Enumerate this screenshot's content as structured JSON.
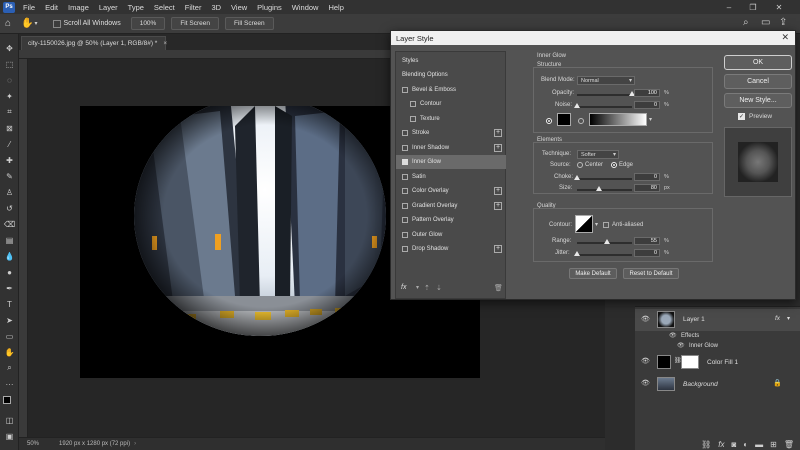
{
  "menubar": {
    "logo": "Ps",
    "items": [
      "File",
      "Edit",
      "Image",
      "Layer",
      "Type",
      "Select",
      "Filter",
      "3D",
      "View",
      "Plugins",
      "Window",
      "Help"
    ]
  },
  "optionsbar": {
    "scroll_all_windows": "Scroll All Windows",
    "zoom": "100%",
    "fit_screen": "Fit Screen",
    "fill_screen": "Fill Screen"
  },
  "document": {
    "tab_title": "city-1150026.jpg @ 50% (Layer 1, RGB/8#) *",
    "tab_close": "×",
    "zoom": "50%",
    "doc_info": "1920 px x 1280 px (72 ppi)"
  },
  "dialog": {
    "title": "Layer Style",
    "styles_header": "Styles",
    "styles": [
      {
        "label": "Blending Options",
        "checkbox": false,
        "plus": false,
        "checked": false,
        "selected": false
      },
      {
        "label": "Bevel & Emboss",
        "checkbox": true,
        "plus": false,
        "checked": false,
        "selected": false
      },
      {
        "label": "Contour",
        "checkbox": true,
        "plus": false,
        "checked": false,
        "selected": false,
        "indent": true
      },
      {
        "label": "Texture",
        "checkbox": true,
        "plus": false,
        "checked": false,
        "selected": false,
        "indent": true
      },
      {
        "label": "Stroke",
        "checkbox": true,
        "plus": true,
        "checked": false,
        "selected": false
      },
      {
        "label": "Inner Shadow",
        "checkbox": true,
        "plus": true,
        "checked": false,
        "selected": false
      },
      {
        "label": "Inner Glow",
        "checkbox": true,
        "plus": false,
        "checked": true,
        "selected": true
      },
      {
        "label": "Satin",
        "checkbox": true,
        "plus": false,
        "checked": false,
        "selected": false
      },
      {
        "label": "Color Overlay",
        "checkbox": true,
        "plus": true,
        "checked": false,
        "selected": false
      },
      {
        "label": "Gradient Overlay",
        "checkbox": true,
        "plus": true,
        "checked": false,
        "selected": false
      },
      {
        "label": "Pattern Overlay",
        "checkbox": true,
        "plus": false,
        "checked": false,
        "selected": false
      },
      {
        "label": "Outer Glow",
        "checkbox": true,
        "plus": false,
        "checked": false,
        "selected": false
      },
      {
        "label": "Drop Shadow",
        "checkbox": true,
        "plus": true,
        "checked": false,
        "selected": false
      }
    ],
    "inner_glow": {
      "section_title": "Inner Glow",
      "structure": "Structure",
      "blend_mode_label": "Blend Mode:",
      "blend_mode": "Normal",
      "opacity_label": "Opacity:",
      "opacity": "100",
      "noise_label": "Noise:",
      "noise": "0",
      "percent": "%",
      "elements": "Elements",
      "technique_label": "Technique:",
      "technique": "Softer",
      "source_label": "Source:",
      "source_center": "Center",
      "source_edge": "Edge",
      "source_selected": "Edge",
      "choke_label": "Choke:",
      "choke": "0",
      "size_label": "Size:",
      "size": "80",
      "px": "px",
      "quality": "Quality",
      "contour_label": "Contour:",
      "anti_aliased": "Anti-aliased",
      "range_label": "Range:",
      "range": "55",
      "jitter_label": "Jitter:",
      "jitter": "0",
      "make_default": "Make Default",
      "reset_default": "Reset to Default"
    },
    "buttons": {
      "ok": "OK",
      "cancel": "Cancel",
      "new_style": "New Style..."
    },
    "preview_label": "Preview",
    "fx_label": "fx",
    "opacity_slider_value": 1.0,
    "size_slider_value": 0.4,
    "range_slider_value": 0.55
  },
  "layers": {
    "rows": [
      {
        "name": "Layer 1",
        "fx": "fx"
      },
      {
        "name": "Effects"
      },
      {
        "name": "Inner Glow"
      },
      {
        "name": "Color Fill 1"
      },
      {
        "name": "Background"
      }
    ]
  },
  "colors": {
    "accent": "#2b5fb4",
    "dialog_bg": "#535353",
    "canvas_bg": "#262626"
  }
}
